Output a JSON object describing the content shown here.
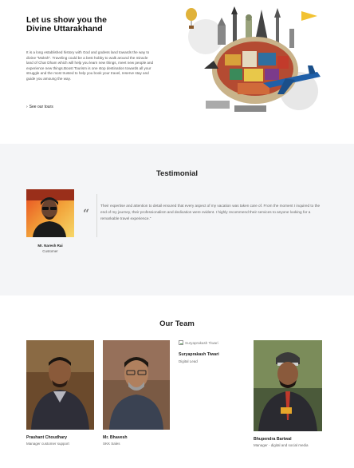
{
  "intro": {
    "title": "Let us show you the Divine Uttarakhand",
    "text": "It is a long established history with God and godess land towards the way to divine \"Moksh\". Traveling could be a best hobby to walk around the miracle land of Char Dham which will help you learn new things, meet new people and experience new things.Boost Tourism is one stop destination towards all your struggle and the most trusted to help you book your travel, reserve stay and guide you amoung the way.",
    "link": "See our tours",
    "link_icon": "arrow-right-icon"
  },
  "testimonial": {
    "heading": "Testimonial",
    "name": "Mr. Naresh Rai",
    "role": "Customer",
    "quote_mark": "“",
    "quote": "Their expertise and attention to detail ensured that every aspect of my vacation was taken care of. From the moment I inquired to the end of my journey, their professionalism and dedication were evident. I highly recommend their services to anyone looking for a remarkable travel experience.\""
  },
  "team": {
    "heading": "Our Team",
    "members": [
      {
        "name": "Prashant Choudhary",
        "role": "Manager customer support"
      },
      {
        "name": "Mr. Bhavesh",
        "role": "SKK Sales"
      },
      {
        "name": "Suryaprakash Tiwari",
        "role": "Digital Lead",
        "image_alt": "Suryaprakash Tiwari"
      },
      {
        "name": "Bhupendra Bartwal",
        "role": "Manager - digital and social media"
      }
    ]
  },
  "colors": {
    "testimonial_bg": "#f4f5f7",
    "heading": "#222222",
    "body_text": "#555555"
  }
}
